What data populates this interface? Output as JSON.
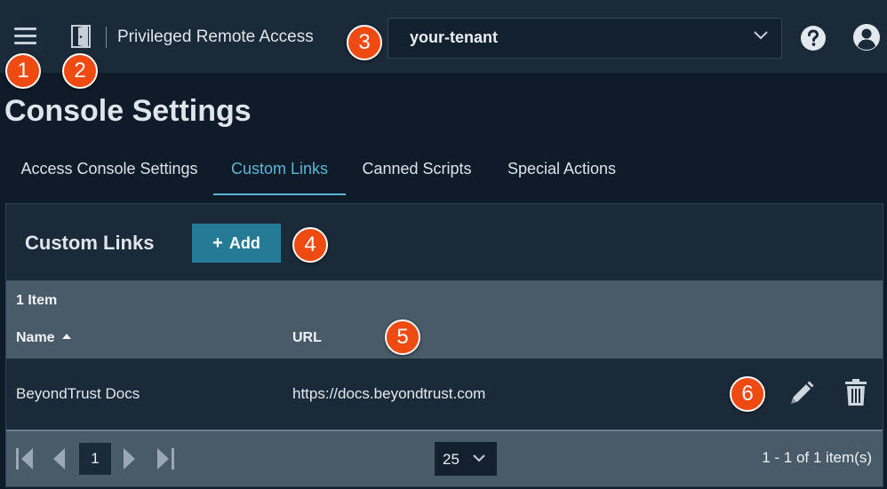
{
  "header": {
    "app_title": "Privileged Remote Access",
    "tenant_value": "your-tenant"
  },
  "page": {
    "title": "Console Settings"
  },
  "tabs": [
    {
      "label": "Access Console Settings",
      "active": false
    },
    {
      "label": "Custom Links",
      "active": true
    },
    {
      "label": "Canned Scripts",
      "active": false
    },
    {
      "label": "Special Actions",
      "active": false
    }
  ],
  "panel": {
    "title": "Custom Links",
    "add_label": "Add",
    "item_count": "1 Item",
    "columns": {
      "name": "Name",
      "url": "URL"
    },
    "rows": [
      {
        "name": "BeyondTrust Docs",
        "url": "https://docs.beyondtrust.com"
      }
    ]
  },
  "pager": {
    "current_page": "1",
    "page_size": "25",
    "range_text": "1 - 1 of 1 item(s)"
  },
  "markers": [
    "1",
    "2",
    "3",
    "4",
    "5",
    "6"
  ],
  "icons": {
    "menu": "hamburger-menu-icon",
    "portal": "door-icon",
    "help": "question-mark-icon",
    "user": "user-avatar-icon",
    "edit": "pencil-icon",
    "delete": "trash-icon"
  },
  "colors": {
    "background": "#0f1b28",
    "bar": "#1b2a38",
    "accent": "#59b6d8",
    "button": "#257a96",
    "marker": "#ef4a12"
  }
}
